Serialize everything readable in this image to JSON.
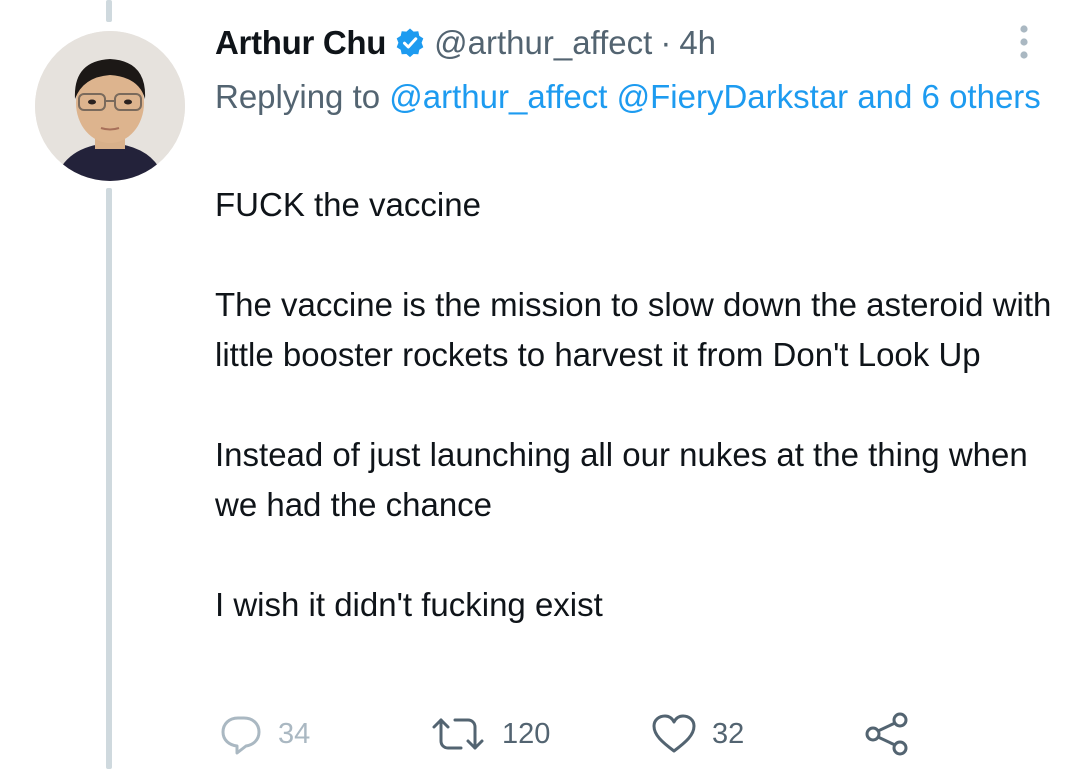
{
  "tweet": {
    "author": {
      "name": "Arthur Chu",
      "handle": "@arthur_affect",
      "verified": true,
      "avatar": "avatar-photo"
    },
    "separator": "·",
    "time": "4h",
    "replying": {
      "prefix": "Replying to",
      "mention_1": "@arthur_affect",
      "mention_2": "@FieryDarkstar",
      "suffix": "and 6 others"
    },
    "paragraphs": [
      "FUCK the vaccine",
      "The vaccine is the mission to slow down the asteroid with little booster rockets to harvest it from Don't Look Up",
      "Instead of just launching all our nukes at the thing when we had the chance",
      "I wish it didn't fucking exist"
    ],
    "actions": {
      "reply_count": "34",
      "retweet_count": "120",
      "like_count": "32"
    }
  },
  "icons": {
    "verified": "verified-badge-icon",
    "more": "more-options-icon",
    "reply": "reply-icon",
    "retweet": "retweet-icon",
    "like": "heart-icon",
    "share": "share-icon"
  },
  "colors": {
    "text": "#0f1419",
    "secondary": "#536471",
    "link": "#1d9bf0",
    "thread_line": "#cfd9de"
  }
}
